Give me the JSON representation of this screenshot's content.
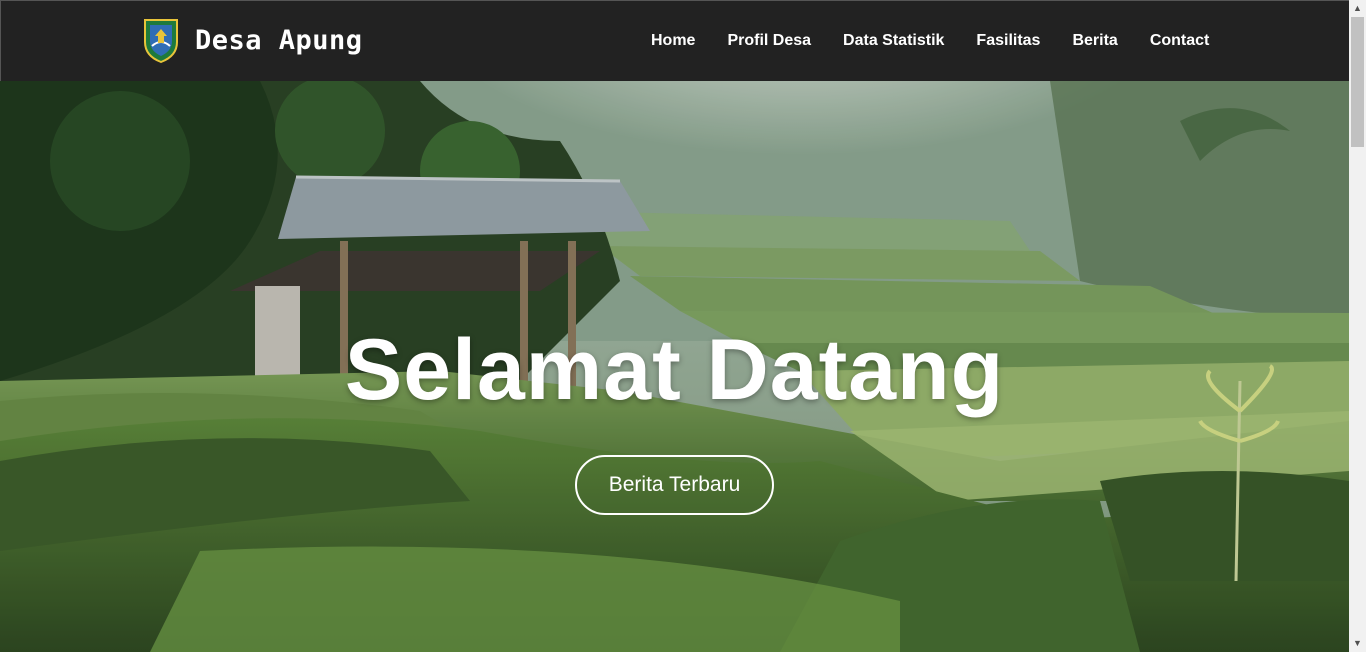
{
  "brand": {
    "name": "Desa Apung",
    "logo_icon": "village-emblem-icon"
  },
  "nav": {
    "items": [
      "Home",
      "Profil Desa",
      "Data Statistik",
      "Fasilitas",
      "Berita",
      "Contact"
    ]
  },
  "hero": {
    "title": "Selamat Datang",
    "button_label": "Berita Terbaru"
  },
  "colors": {
    "navbar": "#222222",
    "text": "#ffffff",
    "rice_field": "#5d8a3e"
  }
}
